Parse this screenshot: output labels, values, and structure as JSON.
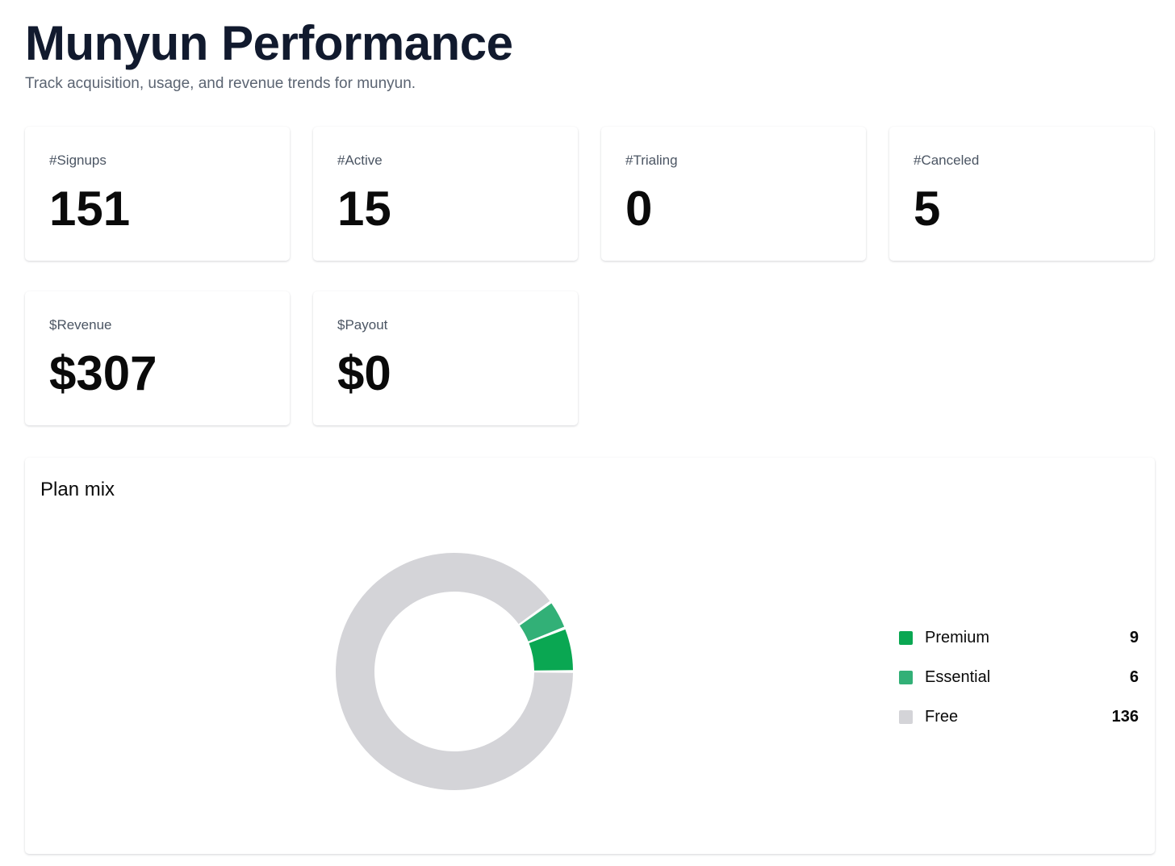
{
  "header": {
    "title": "Munyun Performance",
    "subtitle": "Track acquisition, usage, and revenue trends for munyun."
  },
  "stats": [
    {
      "label": "#Signups",
      "value": "151"
    },
    {
      "label": "#Active",
      "value": "15"
    },
    {
      "label": "#Trialing",
      "value": "0"
    },
    {
      "label": "#Canceled",
      "value": "5"
    },
    {
      "label": "$Revenue",
      "value": "$307"
    },
    {
      "label": "$Payout",
      "value": "$0"
    }
  ],
  "chart_data": {
    "type": "pie",
    "title": "Plan mix",
    "donut": true,
    "legend_position": "right",
    "categories": [
      "Premium",
      "Essential",
      "Free"
    ],
    "values": [
      9,
      6,
      136
    ],
    "colors": [
      "#0aa752",
      "#32b077",
      "#d4d4d8"
    ]
  }
}
